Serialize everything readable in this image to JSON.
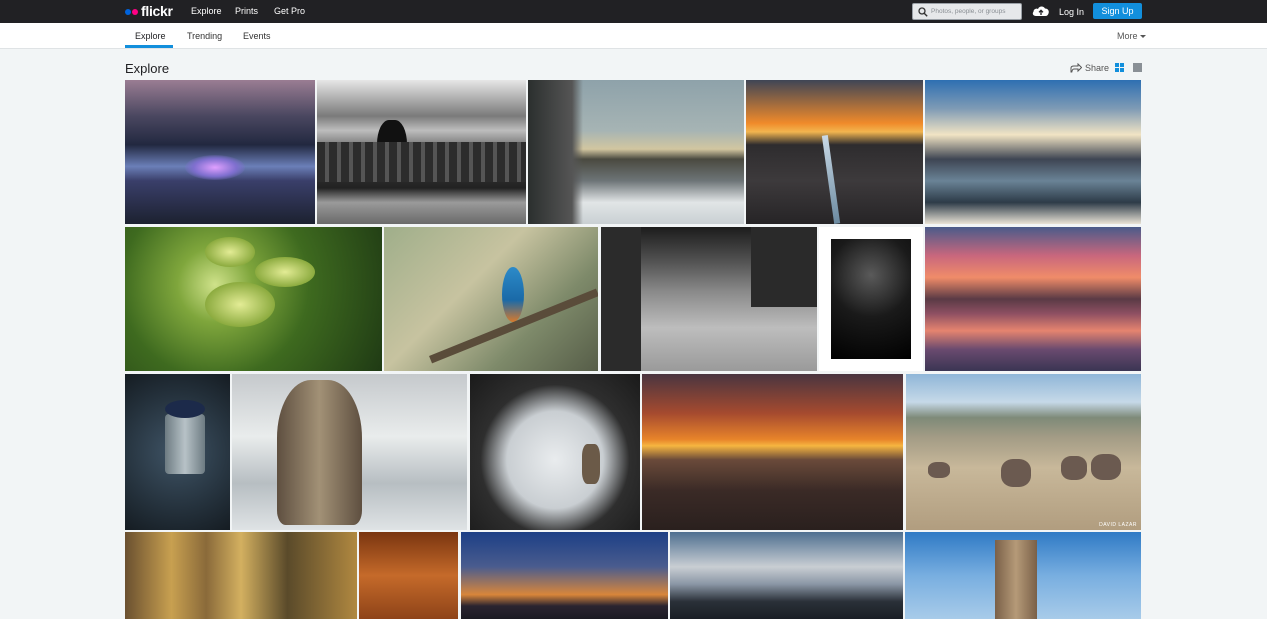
{
  "brand": {
    "name": "flickr",
    "blue": "#0063dc",
    "pink": "#ff0084"
  },
  "topnav": {
    "items": [
      {
        "label": "Explore"
      },
      {
        "label": "Prints"
      },
      {
        "label": "Get Pro"
      }
    ],
    "search_placeholder": "Photos, people, or groups",
    "upload_icon": "cloud-upload-icon",
    "login_label": "Log In",
    "signup_label": "Sign Up"
  },
  "subnav": {
    "tabs": [
      {
        "label": "Explore",
        "active": true
      },
      {
        "label": "Trending",
        "active": false
      },
      {
        "label": "Events",
        "active": false
      }
    ],
    "more_label": "More"
  },
  "page": {
    "title": "Explore",
    "share_label": "Share",
    "view_modes": [
      "justified-view-icon",
      "detail-view-icon"
    ]
  },
  "photos": [
    {
      "subject": "misty valley at dusk"
    },
    {
      "subject": "equestrian statue plaza black and white"
    },
    {
      "subject": "winter trees by lake"
    },
    {
      "subject": "coastal ravine sunset"
    },
    {
      "subject": "stormy sea with pier"
    },
    {
      "subject": "green fennel flowers"
    },
    {
      "subject": "kingfisher on branch"
    },
    {
      "subject": "children on road black and white"
    },
    {
      "subject": "lone figure on rock black and white"
    },
    {
      "subject": "pink sunset lake reflection"
    },
    {
      "subject": "blueberries in tin jug"
    },
    {
      "subject": "wooden owl carving in snow"
    },
    {
      "subject": "deer in snowy tree arch"
    },
    {
      "subject": "rocky shore sunset"
    },
    {
      "subject": "elephants bathing in river"
    },
    {
      "subject": "golden forest double exposure"
    },
    {
      "subject": "rusty ship hull"
    },
    {
      "subject": "city skyline at dusk"
    },
    {
      "subject": "manhattan skyline long exposure"
    },
    {
      "subject": "stone tower ruin"
    }
  ],
  "watermarks": {
    "elephants": "DAVID LAZAR"
  }
}
